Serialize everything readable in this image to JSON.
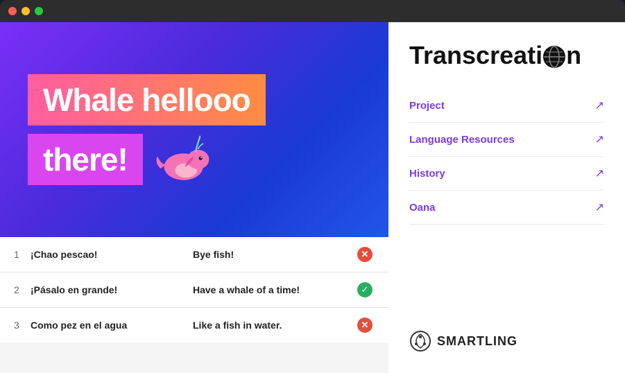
{
  "titlebar": {
    "dots": [
      "red",
      "yellow",
      "green"
    ]
  },
  "hero": {
    "line1": "Whale hellooo",
    "line2": "there!"
  },
  "table": {
    "rows": [
      {
        "num": "1",
        "source": "¡Chao pescao!",
        "target": "Bye fish!",
        "status": "x"
      },
      {
        "num": "2",
        "source": "¡Pásalo en grande!",
        "target": "Have a whale of a time!",
        "status": "check"
      },
      {
        "num": "3",
        "source": "Como pez en el agua",
        "target": "Like a fish in water.",
        "status": "x"
      }
    ]
  },
  "sidebar": {
    "title_part1": "Transcreati",
    "title_part2": "n",
    "nav_items": [
      {
        "label": "Project"
      },
      {
        "label": "Language Resources"
      },
      {
        "label": "History"
      },
      {
        "label": "Oana"
      }
    ],
    "smartling_label": "SMARTLING"
  }
}
